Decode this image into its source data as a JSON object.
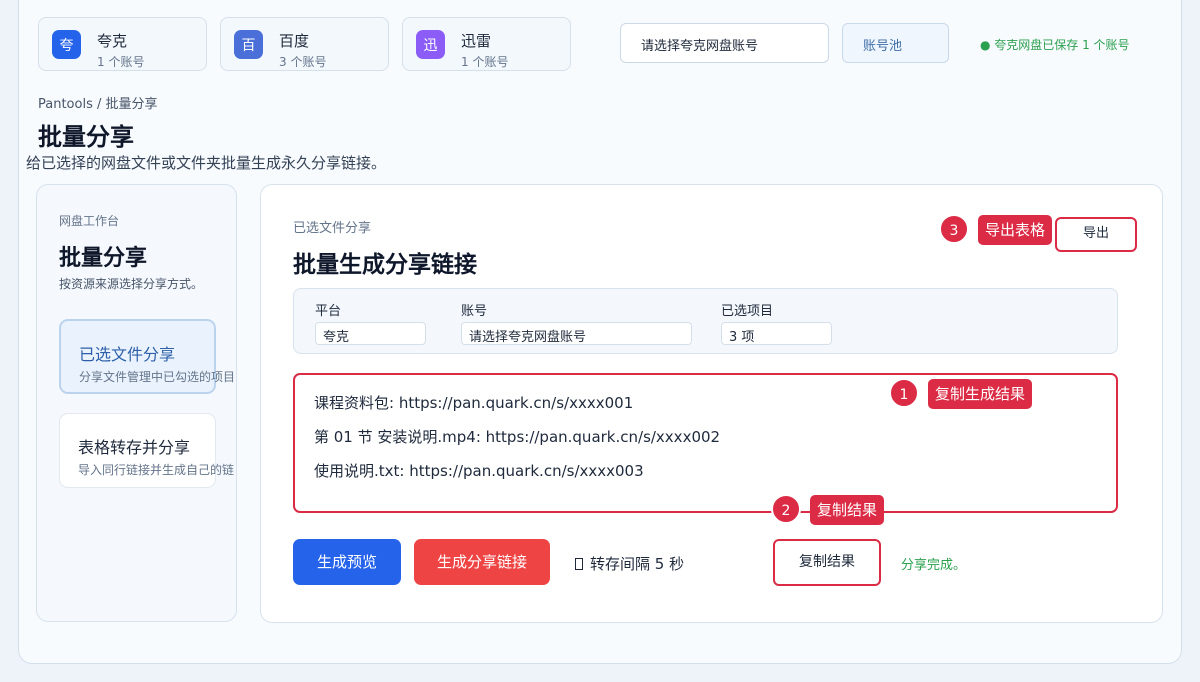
{
  "accounts": [
    {
      "icon": "夸",
      "name": "夸克",
      "count": "1 个账号",
      "color": "#2563eb"
    },
    {
      "icon": "百",
      "name": "百度",
      "count": "3 个账号",
      "color": "#4a6fd8"
    },
    {
      "icon": "迅",
      "name": "迅雷",
      "count": "1 个账号",
      "color": "#8b5cf6"
    }
  ],
  "topbar": {
    "account_select": "请选择夸克网盘账号",
    "pool_button": "账号池",
    "saved_status": "● 夸克网盘已保存 1 个账号"
  },
  "breadcrumb": "Pantools / 批量分享",
  "page": {
    "title": "批量分享",
    "description": "给已选择的网盘文件或文件夹批量生成永久分享链接。"
  },
  "sidebar": {
    "kicker": "网盘工作台",
    "title": "批量分享",
    "subtitle": "按资源来源选择分享方式。",
    "modes": [
      {
        "label": "已选文件分享",
        "desc": "分享文件管理中已勾选的项目"
      },
      {
        "label": "表格转存并分享",
        "desc": "导入同行链接并生成自己的链"
      }
    ]
  },
  "panel": {
    "kicker": "已选文件分享",
    "title": "批量生成分享链接",
    "export_button": "导出",
    "fields": {
      "platform_label": "平台",
      "platform_value": "夸克",
      "account_label": "账号",
      "account_value": "请选择夸克网盘账号",
      "selected_label": "已选项目",
      "selected_value": "3 项"
    },
    "results": [
      "课程资料包: https://pan.quark.cn/s/xxxx001",
      "第 01 节 安装说明.mp4: https://pan.quark.cn/s/xxxx002",
      "使用说明.txt: https://pan.quark.cn/s/xxxx003"
    ],
    "preview_button": "生成预览",
    "generate_button": "生成分享链接",
    "interval_text": "转存间隔  5 秒",
    "copy_button": "复制结果",
    "done_status": "分享完成。"
  },
  "annotations": [
    {
      "number": "1",
      "label": "复制生成结果"
    },
    {
      "number": "2",
      "label": "复制结果"
    },
    {
      "number": "3",
      "label": "导出表格"
    }
  ]
}
